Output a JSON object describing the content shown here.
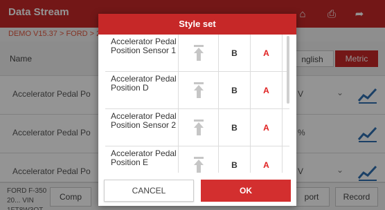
{
  "app": {
    "title": "Data Stream",
    "breadcrumb": "DEMO V15.37 > FORD > 2",
    "column_name_header": "Name",
    "unit_toggle": {
      "english": "nglish",
      "metric": "Metric"
    },
    "rows": [
      {
        "name": "Accelerator Pedal Po",
        "unit": "V",
        "has_dropdown": true
      },
      {
        "name": "Accelerator Pedal Po",
        "unit": "%",
        "has_dropdown": false
      },
      {
        "name": "Accelerator Pedal Po",
        "unit": "V",
        "has_dropdown": true
      }
    ],
    "vehicle_info": "FORD F-350 20... VIN 1FT8W3OT...",
    "bottom_buttons": {
      "compare": "Comp",
      "report": "port",
      "record": "Record"
    },
    "icons": {
      "toolbar": [
        "home-icon",
        "print-icon",
        "exit-icon"
      ],
      "row_graph": "line-graph-icon"
    },
    "colors": {
      "brand_red": "#c62828",
      "accent_a": "#e02020"
    }
  },
  "dialog": {
    "title": "Style set",
    "items": [
      {
        "name": "Accelerator Pedal Position Sensor 1",
        "b_label": "B",
        "a_label": "A"
      },
      {
        "name": "Accelerator Pedal Position D",
        "b_label": "B",
        "a_label": "A"
      },
      {
        "name": "Accelerator Pedal Position Sensor 2",
        "b_label": "B",
        "a_label": "A"
      },
      {
        "name": "Accelerator Pedal Position E",
        "b_label": "B",
        "a_label": "A"
      }
    ],
    "cancel_label": "CANCEL",
    "ok_label": "OK"
  }
}
